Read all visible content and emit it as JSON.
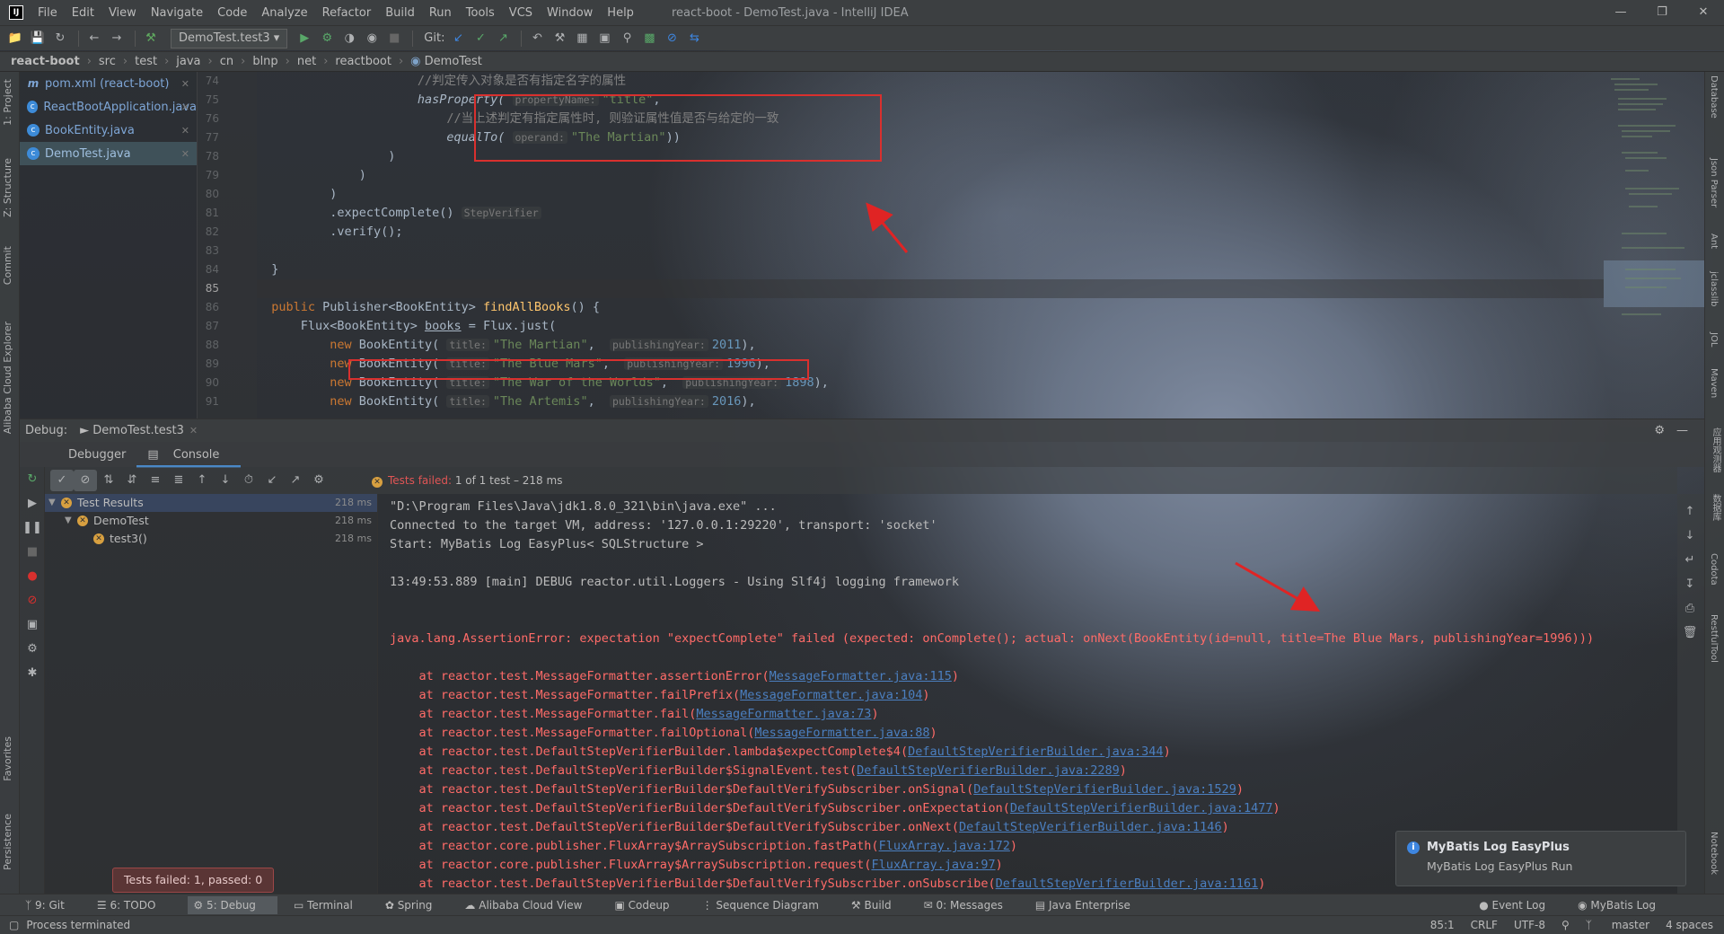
{
  "window": {
    "title": "react-boot - DemoTest.java - IntelliJ IDEA"
  },
  "menu": [
    "File",
    "Edit",
    "View",
    "Navigate",
    "Code",
    "Analyze",
    "Refactor",
    "Build",
    "Run",
    "Tools",
    "VCS",
    "Window",
    "Help"
  ],
  "toolbar": {
    "run_config": "DemoTest.test3",
    "git_label": "Git:"
  },
  "breadcrumb": [
    "react-boot",
    "src",
    "test",
    "java",
    "cn",
    "blnp",
    "net",
    "reactboot",
    "DemoTest"
  ],
  "file_tabs": [
    {
      "label": "pom.xml (react-boot)",
      "icon": "maven-icon"
    },
    {
      "label": "ReactBootApplication.java",
      "icon": "class-icon"
    },
    {
      "label": "BookEntity.java",
      "icon": "class-icon"
    },
    {
      "label": "DemoTest.java",
      "icon": "class-icon",
      "active": true
    }
  ],
  "editor": {
    "line_numbers": [
      "74",
      "75",
      "76",
      "77",
      "78",
      "79",
      "80",
      "81",
      "82",
      "83",
      "84",
      "85",
      "86",
      "87",
      "88",
      "89",
      "90",
      "91"
    ],
    "lines": {
      "l74": "//判定传入对象是否有指定名字的属性",
      "l75_fn": "hasProperty(",
      "l75_hint": "propertyName:",
      "l75_str": "\"title\"",
      "l76": "//当上述判定有指定属性时, 则验证属性值是否与给定的一致",
      "l77_fn": "equalTo(",
      "l77_hint": "operand:",
      "l77_str": "\"The Martian\"",
      "l81": ".expectComplete()",
      "l81_hint": "StepVerifier",
      "l82": ".verify();",
      "l86_kw": "public",
      "l86_rest": " Publisher<BookEntity> ",
      "l86_fn": "findAllBooks",
      "l86_end": "() {",
      "l87_a": "Flux<BookEntity> ",
      "l87_var": "books",
      "l87_b": " = Flux.just(",
      "new_kw": "new",
      "ctor": " BookEntity(",
      "title_hint": "title:",
      "year_hint": "publishingYear:",
      "books": [
        {
          "title": "\"The Martian\"",
          "year": "2011"
        },
        {
          "title": "\"The Blue Mars\"",
          "year": "1996"
        },
        {
          "title": "\"The War of the Worlds\"",
          "year": "1898"
        },
        {
          "title": "\"The Artemis\"",
          "year": "2016"
        }
      ]
    }
  },
  "debug": {
    "label": "Debug:",
    "tab": "DemoTest.test3",
    "subtabs": [
      "Debugger",
      "Console"
    ],
    "status_prefix": "Tests failed:",
    "status_rest": "1 of 1 test – 218 ms"
  },
  "tree": [
    {
      "label": "Test Results",
      "time": "218 ms"
    },
    {
      "label": "DemoTest",
      "time": "218 ms"
    },
    {
      "label": "test3()",
      "time": "218 ms"
    }
  ],
  "console": [
    "\"D:\\Program Files\\Java\\jdk1.8.0_321\\bin\\java.exe\" ...",
    "Connected to the target VM, address: '127.0.0.1:29220', transport: 'socket'",
    "Start: MyBatis Log EasyPlus< SQLStructure >",
    "",
    "13:49:53.889 [main] DEBUG reactor.util.Loggers - Using Slf4j logging framework",
    "",
    "",
    "java.lang.AssertionError: expectation \"expectComplete\" failed (expected: onComplete(); actual: onNext(BookEntity(id=null, title=The Blue Mars, publishingYear=1996)))",
    ""
  ],
  "stack": [
    {
      "m": "    at reactor.test.MessageFormatter.assertionError(",
      "l": "MessageFormatter.java:115"
    },
    {
      "m": "    at reactor.test.MessageFormatter.failPrefix(",
      "l": "MessageFormatter.java:104"
    },
    {
      "m": "    at reactor.test.MessageFormatter.fail(",
      "l": "MessageFormatter.java:73"
    },
    {
      "m": "    at reactor.test.MessageFormatter.failOptional(",
      "l": "MessageFormatter.java:88"
    },
    {
      "m": "    at reactor.test.DefaultStepVerifierBuilder.lambda$expectComplete$4(",
      "l": "DefaultStepVerifierBuilder.java:344"
    },
    {
      "m": "    at reactor.test.DefaultStepVerifierBuilder$SignalEvent.test(",
      "l": "DefaultStepVerifierBuilder.java:2289"
    },
    {
      "m": "    at reactor.test.DefaultStepVerifierBuilder$DefaultVerifySubscriber.onSignal(",
      "l": "DefaultStepVerifierBuilder.java:1529"
    },
    {
      "m": "    at reactor.test.DefaultStepVerifierBuilder$DefaultVerifySubscriber.onExpectation(",
      "l": "DefaultStepVerifierBuilder.java:1477"
    },
    {
      "m": "    at reactor.test.DefaultStepVerifierBuilder$DefaultVerifySubscriber.onNext(",
      "l": "DefaultStepVerifierBuilder.java:1146"
    },
    {
      "m": "    at reactor.core.publisher.FluxArray$ArraySubscription.fastPath(",
      "l": "FluxArray.java:172"
    },
    {
      "m": "    at reactor.core.publisher.FluxArray$ArraySubscription.request(",
      "l": "FluxArray.java:97"
    },
    {
      "m": "    at reactor.test.DefaultStepVerifierBuilder$DefaultVerifySubscriber.onSubscribe(",
      "l": "DefaultStepVerifierBuilder.java:1161"
    }
  ],
  "balloon": "Tests failed: 1, passed: 0",
  "notification": {
    "title": "MyBatis Log EasyPlus",
    "body": "MyBatis Log EasyPlus Run"
  },
  "bottom_tabs": [
    "9: Git",
    "6: TODO",
    "5: Debug",
    "Terminal",
    "Spring",
    "Alibaba Cloud View",
    "Codeup",
    "Sequence Diagram",
    "Build",
    "0: Messages",
    "Java Enterprise"
  ],
  "bottom_right": [
    "Event Log",
    "MyBatis Log"
  ],
  "status": {
    "message": "Process terminated",
    "position": "85:1",
    "line_sep": "CRLF",
    "encoding": "UTF-8",
    "branch": "master",
    "indent": "4 spaces"
  },
  "left_tools": [
    "1: Project",
    "Z: Structure",
    "Commit",
    "Alibaba Cloud Explorer",
    "Favorites",
    "Persistence"
  ],
  "right_tools": [
    "Database",
    "Json Parser",
    "Ant",
    "jclasslib",
    "JOL",
    "Maven",
    "应用观测器",
    "数据库",
    "Codota",
    "RestfulTool",
    "Notebook"
  ]
}
